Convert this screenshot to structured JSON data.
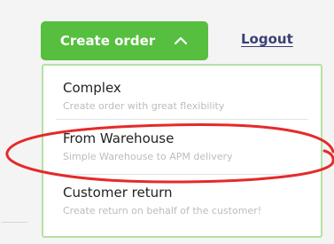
{
  "header": {
    "create_order_label": "Create order",
    "logout_label": "Logout"
  },
  "menu": {
    "options": [
      {
        "title": "Complex",
        "description": "Create order with great flexibility"
      },
      {
        "title": "From Warehouse",
        "description": "Simple Warehouse to APM delivery"
      },
      {
        "title": "Customer return",
        "description": "Create return on behalf of the customer!"
      }
    ]
  },
  "icons": {
    "create_order_chevron": "chevron-up-icon",
    "annotation": "red-highlight-ellipse"
  },
  "colors": {
    "primary_green": "#56bf3f",
    "menu_border": "#b6e1a2",
    "logout_text": "#3a3e76",
    "annotation_red": "#e52a2a",
    "title_text": "#222222",
    "description_text": "#bcbcbc"
  }
}
